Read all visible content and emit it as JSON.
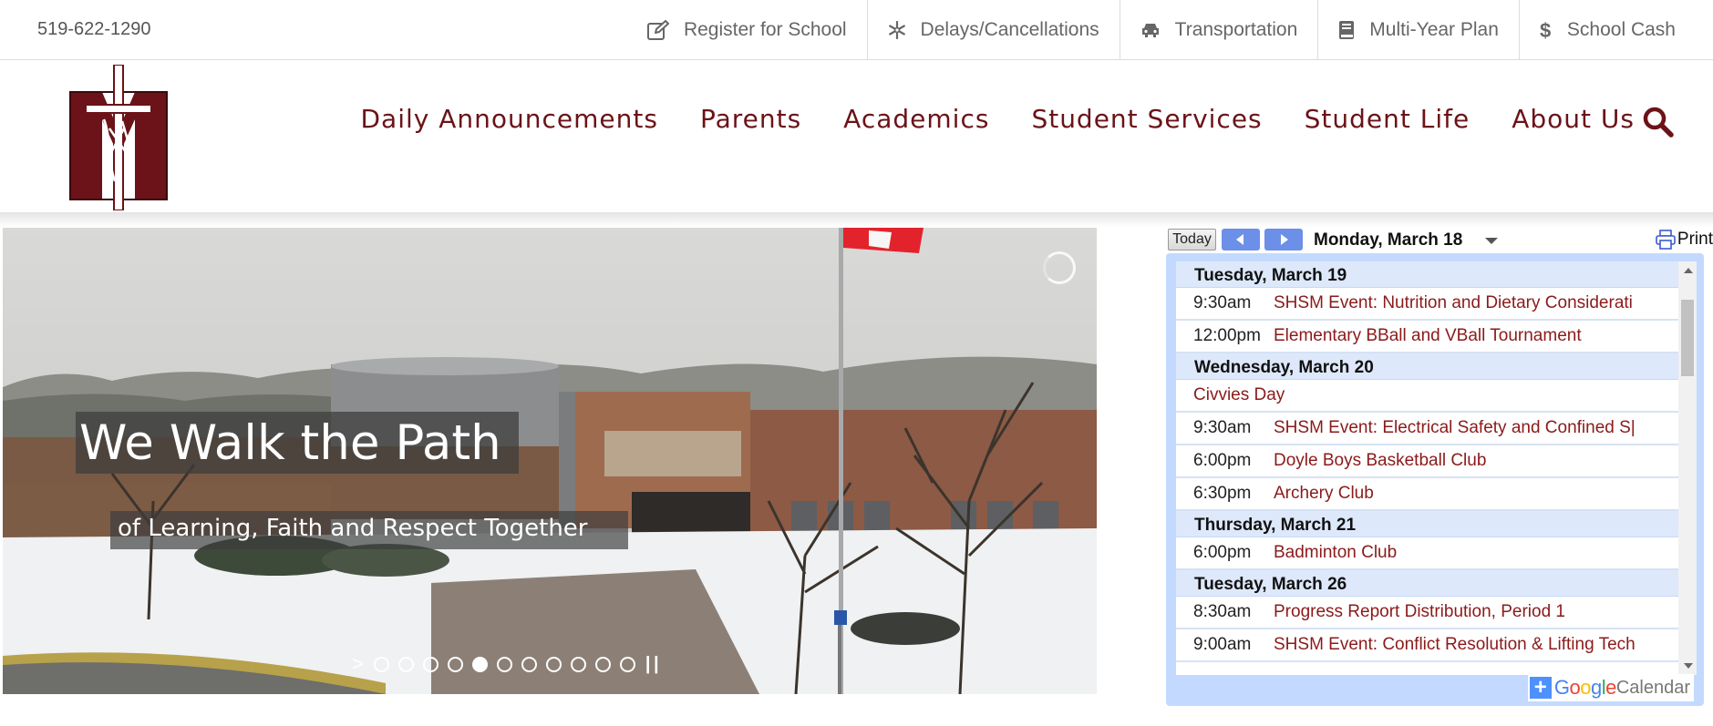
{
  "utility": {
    "phone": "519-622-1290",
    "links": [
      {
        "label": "Register for School",
        "icon": "edit-icon"
      },
      {
        "label": "Delays/Cancellations",
        "icon": "snowflake-icon"
      },
      {
        "label": "Transportation",
        "icon": "car-icon"
      },
      {
        "label": "Multi-Year Plan",
        "icon": "book-icon"
      },
      {
        "label": "School Cash",
        "icon": "dollar-icon"
      }
    ]
  },
  "nav": {
    "items": [
      "Daily Announcements",
      "Parents",
      "Academics",
      "Student Services",
      "Student Life",
      "About Us"
    ],
    "search_icon": "search-icon"
  },
  "hero": {
    "title": "We Walk the Path",
    "subtitle": "of Learning, Faith and Respect Together",
    "active_slide": 5,
    "slide_count": 11
  },
  "calendar": {
    "today_label": "Today",
    "current_date": "Monday, March 18",
    "print_label": "Print",
    "days": [
      {
        "date": "Tuesday, March 19",
        "events": [
          {
            "time": "9:30am",
            "title": "SHSM Event: Nutrition and Dietary Considerati"
          },
          {
            "time": "12:00pm",
            "title": "Elementary BBall and VBall Tournament"
          }
        ]
      },
      {
        "date": "Wednesday, March 20",
        "events": [
          {
            "time": "",
            "title": "Civvies Day"
          },
          {
            "time": "9:30am",
            "title": "SHSM Event: Electrical Safety and Confined S|"
          },
          {
            "time": "6:00pm",
            "title": "Doyle Boys Basketball Club"
          },
          {
            "time": "6:30pm",
            "title": "Archery Club"
          }
        ]
      },
      {
        "date": "Thursday, March 21",
        "events": [
          {
            "time": "6:00pm",
            "title": "Badminton Club"
          }
        ]
      },
      {
        "date": "Tuesday, March 26",
        "events": [
          {
            "time": "8:30am",
            "title": "Progress Report Distribution, Period 1"
          },
          {
            "time": "9:00am",
            "title": "SHSM Event: Conflict Resolution & Lifting Tech"
          }
        ]
      }
    ],
    "google_label": "Google",
    "calendar_label": "Calendar"
  },
  "colors": {
    "brand": "#6b1318",
    "event_link": "#8b1a1a",
    "calendar_bg": "#c3d9ff",
    "calendar_day_bg": "#dde8fa"
  }
}
